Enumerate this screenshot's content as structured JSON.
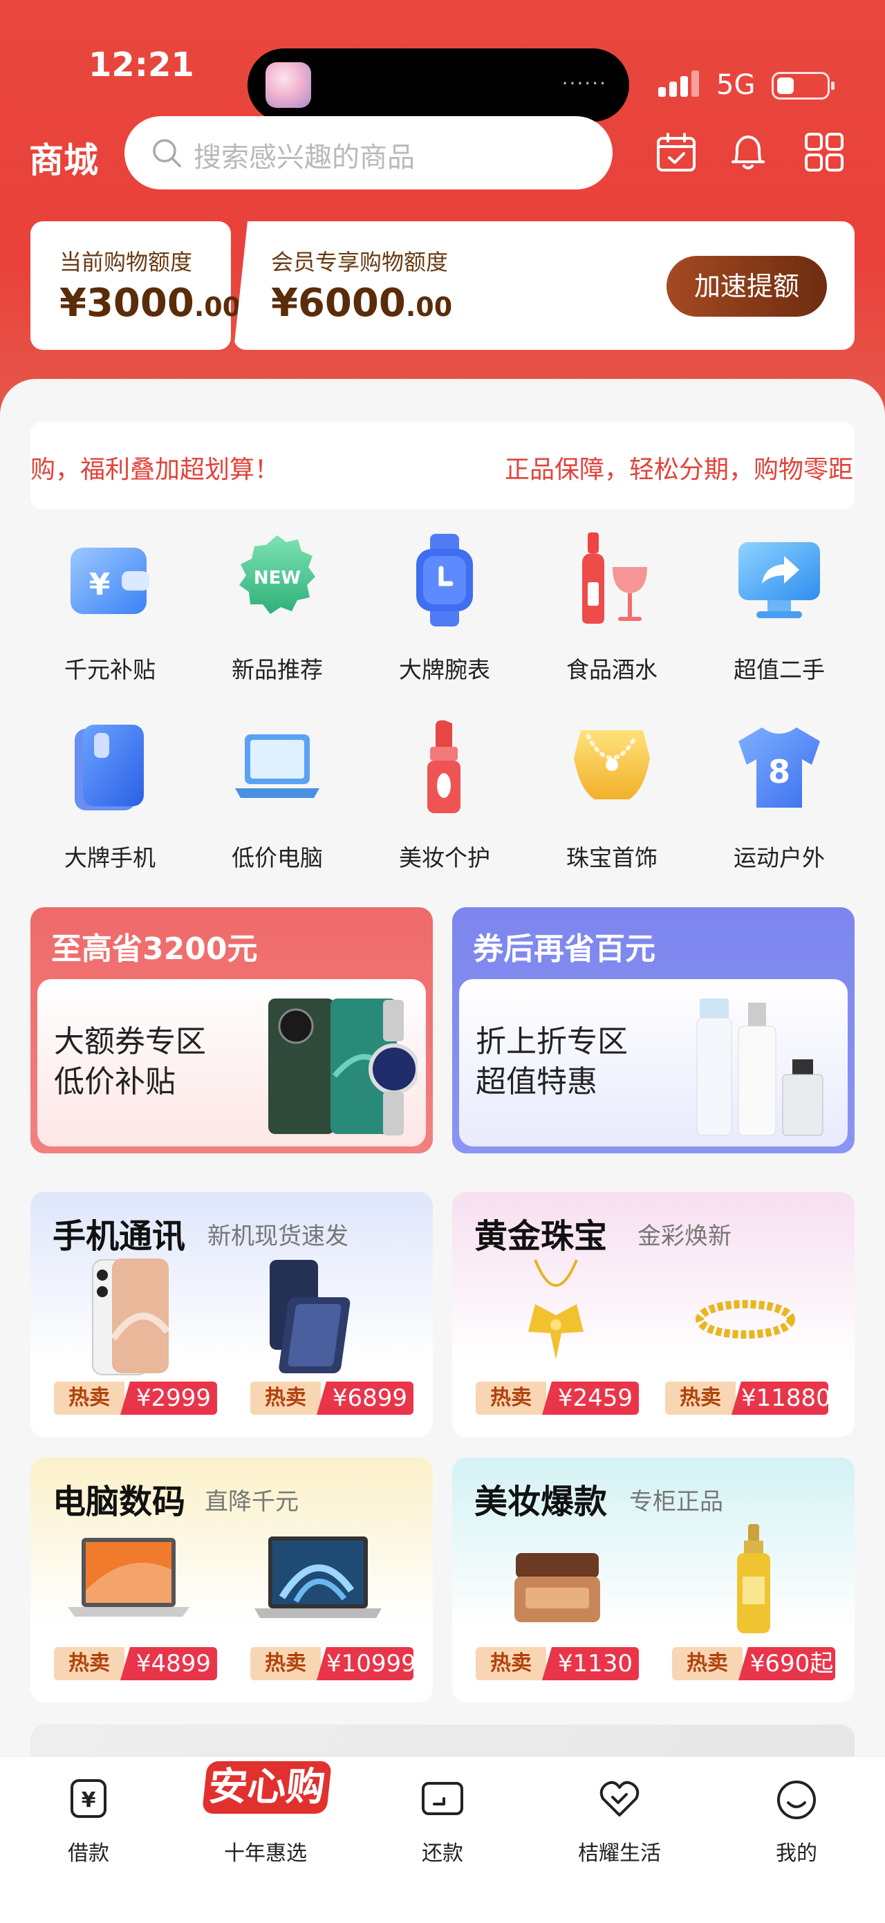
{
  "status_bar": {
    "time": "12:21",
    "network": "5G",
    "island_dots": "······"
  },
  "header": {
    "title": "商城",
    "search_placeholder": "搜索感兴趣的商品"
  },
  "credit": {
    "current_label": "当前购物额度",
    "current_amount": "¥3000",
    "current_decimals": ".00",
    "member_label": "会员专享购物额度",
    "member_amount": "¥6000",
    "member_decimals": ".00",
    "boost_button": "加速提额"
  },
  "marquee": {
    "text_1": "购，福利叠加超划算！",
    "text_2": "正品保障，轻松分期，购物零距"
  },
  "categories": [
    {
      "label": "千元补贴",
      "icon": "wallet-yuan-icon"
    },
    {
      "label": "新品推荐",
      "icon": "new-badge-icon"
    },
    {
      "label": "大牌腕表",
      "icon": "watch-icon"
    },
    {
      "label": "食品酒水",
      "icon": "wine-icon"
    },
    {
      "label": "超值二手",
      "icon": "monitor-share-icon"
    },
    {
      "label": "大牌手机",
      "icon": "phone-icon"
    },
    {
      "label": "低价电脑",
      "icon": "laptop-icon"
    },
    {
      "label": "美妆个护",
      "icon": "lipstick-icon"
    },
    {
      "label": "珠宝首饰",
      "icon": "necklace-icon"
    },
    {
      "label": "运动户外",
      "icon": "jersey-icon"
    }
  ],
  "promos": [
    {
      "headline": "至高省3200元",
      "line1": "大额券专区",
      "line2": "低价补贴"
    },
    {
      "headline": "券后再省百元",
      "line1": "折上折专区",
      "line2": "超值特惠"
    }
  ],
  "product_sections": [
    {
      "title": "手机通讯",
      "subtitle": "新机现货速发",
      "items": [
        {
          "hot": "热卖",
          "price": "¥2999"
        },
        {
          "hot": "热卖",
          "price": "¥6899"
        }
      ]
    },
    {
      "title": "黄金珠宝",
      "subtitle": "金彩焕新",
      "items": [
        {
          "hot": "热卖",
          "price": "¥2459"
        },
        {
          "hot": "热卖",
          "price": "¥11880"
        }
      ]
    },
    {
      "title": "电脑数码",
      "subtitle": "直降千元",
      "items": [
        {
          "hot": "热卖",
          "price": "¥4899"
        },
        {
          "hot": "热卖",
          "price": "¥10999"
        }
      ]
    },
    {
      "title": "美妆爆款",
      "subtitle": "专柜正品",
      "items": [
        {
          "hot": "热卖",
          "price": "¥1130"
        },
        {
          "hot": "热卖",
          "price": "¥690起"
        }
      ]
    }
  ],
  "tabbar": {
    "loan": "借款",
    "special_logo": "安心购",
    "featured": "十年惠选",
    "repay": "还款",
    "life": "桔耀生活",
    "mine": "我的"
  },
  "colors": {
    "brand_red": "#e8473e",
    "price_red": "#e9354a",
    "boost_brown": "#7a3214"
  }
}
